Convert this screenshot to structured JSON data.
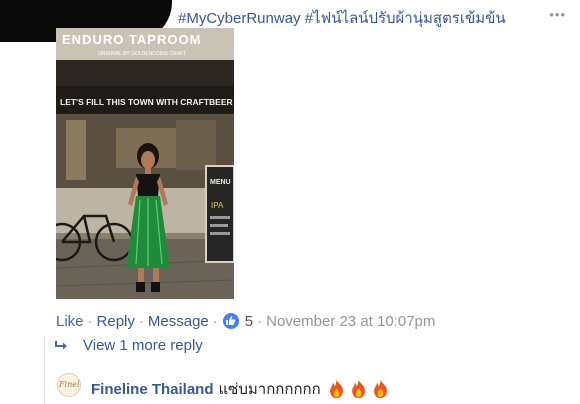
{
  "post": {
    "hashtag_line": "#MyCyberRunway #ไฟน์ไลน์ปรับผ้านุ่มสูตรเข้มข้น",
    "more_icon": "ellipsis-icon"
  },
  "photo": {
    "shop_sign": "ENDURO TAPROOM",
    "sign_subtitle": "ORIGINAL BY GOLDENCOINS CRAFT",
    "banner": "LET'S FILL THIS TOWN WITH CRAFTBEER",
    "menu_board": "MENU",
    "menu_sub": "IPA"
  },
  "actions": {
    "like": "Like",
    "reply": "Reply",
    "message": "Message",
    "reaction_count": "5",
    "timestamp": "November 23 at 10:07pm",
    "separator": "·"
  },
  "replies": {
    "view_more": "View 1 more reply"
  },
  "comment": {
    "author": "Fineline Thailand",
    "avatar_text": "Fineline",
    "text": "แซ่บมากกกกกก",
    "emoji_icons": [
      "fire-icon",
      "fire-icon",
      "fire-icon"
    ]
  },
  "colors": {
    "link": "#365899",
    "like": "#4267b2",
    "meta": "#90949c",
    "badge": "#4080ff",
    "skirt": "#1f8a3c"
  }
}
